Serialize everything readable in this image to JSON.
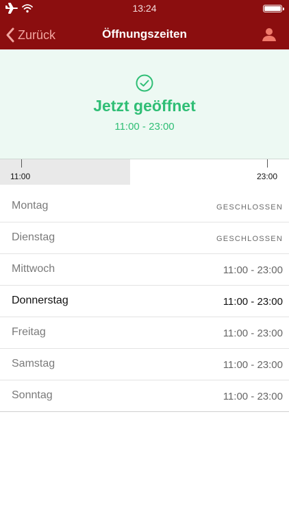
{
  "status_bar": {
    "time": "13:24"
  },
  "nav": {
    "back_label": "Zurück",
    "title": "Öffnungszeiten"
  },
  "banner": {
    "status": "Jetzt geöffnet",
    "hours": "11:00 - 23:00"
  },
  "timeline": {
    "start_label": "11:00",
    "end_label": "23:00",
    "progress_fraction": 0.45
  },
  "schedule": [
    {
      "day": "Montag",
      "hours": "GESCHLOSSEN"
    },
    {
      "day": "Dienstag",
      "hours": "GESCHLOSSEN"
    },
    {
      "day": "Mittwoch",
      "hours": "11:00 - 23:00"
    },
    {
      "day": "Donnerstag",
      "hours": "11:00 - 23:00"
    },
    {
      "day": "Freitag",
      "hours": "11:00 - 23:00"
    },
    {
      "day": "Samstag",
      "hours": "11:00 - 23:00"
    },
    {
      "day": "Sonntag",
      "hours": "11:00 - 23:00"
    }
  ],
  "colors": {
    "nav_background": "#8b0e0f",
    "accent_green": "#2fbe75",
    "back_tint": "#f2a6a0"
  },
  "icons": {
    "airplane": "airplane-icon",
    "wifi": "wifi-icon",
    "battery": "battery-icon",
    "back": "chevron-left-icon",
    "profile": "user-icon",
    "check": "check-circle-icon"
  }
}
